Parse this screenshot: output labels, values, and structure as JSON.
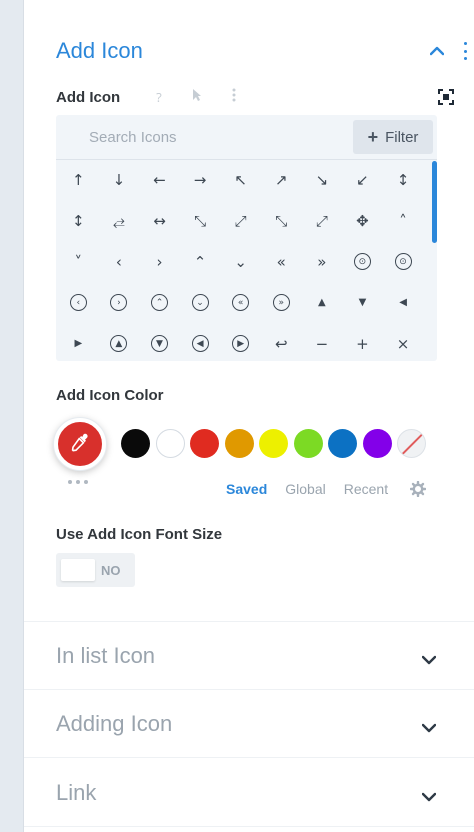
{
  "group": {
    "title": "Add Icon"
  },
  "field": {
    "label": "Add Icon"
  },
  "picker": {
    "search_placeholder": "Search Icons",
    "filter_label": "Filter",
    "icons": [
      "↑",
      "↓",
      "←",
      "→",
      "↖",
      "↗",
      "↘",
      "↙",
      "↕",
      "↕",
      "⥄",
      "↔",
      "⤡",
      "⤢",
      "⤡",
      "⤢",
      "✥",
      "˄",
      "˅",
      "‹",
      "›",
      "⌃",
      "⌄",
      "«",
      "»",
      "⊙",
      "⊙",
      "‹",
      "›",
      "⌃",
      "⌄",
      "«",
      "»",
      "▲",
      "▼",
      "◀",
      "▶",
      "▲",
      "▼",
      "◀",
      "▶",
      "↩",
      "−",
      "+",
      "×"
    ],
    "icon_names": [
      "arrow-up-icon",
      "arrow-down-icon",
      "arrow-left-icon",
      "arrow-right-icon",
      "arrow-up-left-icon",
      "arrow-up-right-icon",
      "arrow-down-right-icon",
      "arrow-down-left-icon",
      "arrow-up-down-icon",
      "arrow-vertical-icon",
      "arrow-horizontal-alt-icon",
      "arrow-left-right-icon",
      "expand-diagonal-icon",
      "expand-diagonal-alt-icon",
      "collapse-icon",
      "expand-icon",
      "move-icon",
      "caret-up-icon",
      "caret-down-icon",
      "caret-left-icon",
      "caret-right-icon",
      "double-caret-up-icon",
      "double-caret-down-icon",
      "double-caret-left-icon",
      "double-caret-right-icon",
      "circle-caret-up-icon",
      "circle-caret-down-icon",
      "circle-caret-left-icon",
      "circle-caret-right-icon",
      "circle-double-up-icon",
      "circle-double-down-icon",
      "circle-double-left-icon",
      "circle-double-right-icon",
      "triangle-up-icon",
      "triangle-down-icon",
      "triangle-left-icon",
      "triangle-right-icon",
      "circle-triangle-up-icon",
      "circle-triangle-down-icon",
      "circle-triangle-left-icon",
      "circle-triangle-right-icon",
      "undo-icon",
      "minus-icon",
      "plus-icon",
      "close-icon"
    ]
  },
  "color": {
    "label": "Add Icon Color",
    "current": "#d8302c",
    "swatches": [
      "#0a0a0a",
      "#ffffff",
      "#e02b20",
      "#e09900",
      "#edf000",
      "#7cda24",
      "#0c71c3",
      "#8300e9",
      "none"
    ],
    "tabs": {
      "saved": "Saved",
      "global": "Global",
      "recent": "Recent"
    }
  },
  "font_size": {
    "label": "Use Add Icon Font Size",
    "toggle_value": "NO"
  },
  "sections": {
    "in_list": "In list Icon",
    "adding": "Adding Icon",
    "link": "Link"
  },
  "accent": "#2b87da"
}
